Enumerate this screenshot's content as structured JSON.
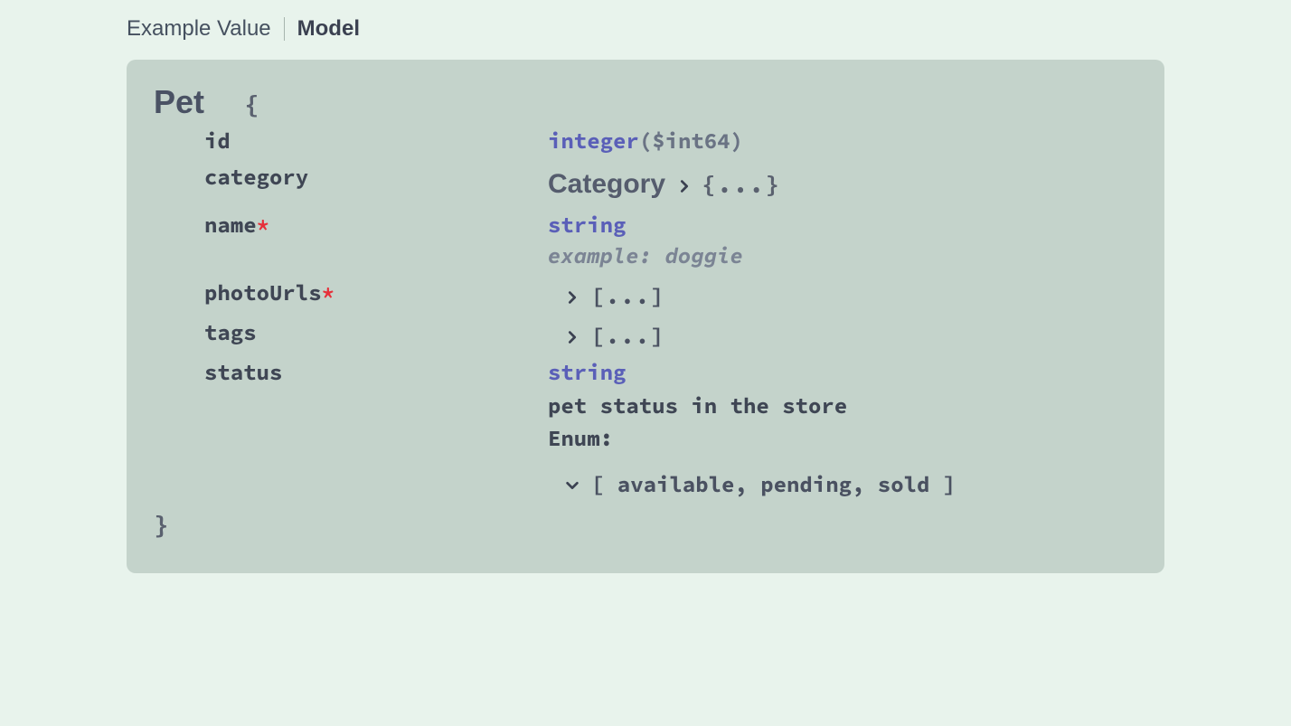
{
  "tabs": {
    "example_value": "Example Value",
    "model": "Model"
  },
  "model": {
    "name": "Pet",
    "open_brace": "{",
    "close_brace": "}",
    "props": {
      "id": {
        "label": "id",
        "type": "integer",
        "format": "($int64)"
      },
      "category": {
        "label": "category",
        "ref_model": "Category",
        "collapsed": "{...}"
      },
      "name": {
        "label": "name",
        "required_star": "*",
        "type": "string",
        "example": "example: doggie"
      },
      "photoUrls": {
        "label": "photoUrls",
        "required_star": "*",
        "collapsed": "[...]"
      },
      "tags": {
        "label": "tags",
        "collapsed": "[...]"
      },
      "status": {
        "label": "status",
        "type": "string",
        "description": "pet status in the store",
        "enum_label": "Enum:",
        "enum_display": "[ available, pending, sold ]"
      }
    }
  }
}
